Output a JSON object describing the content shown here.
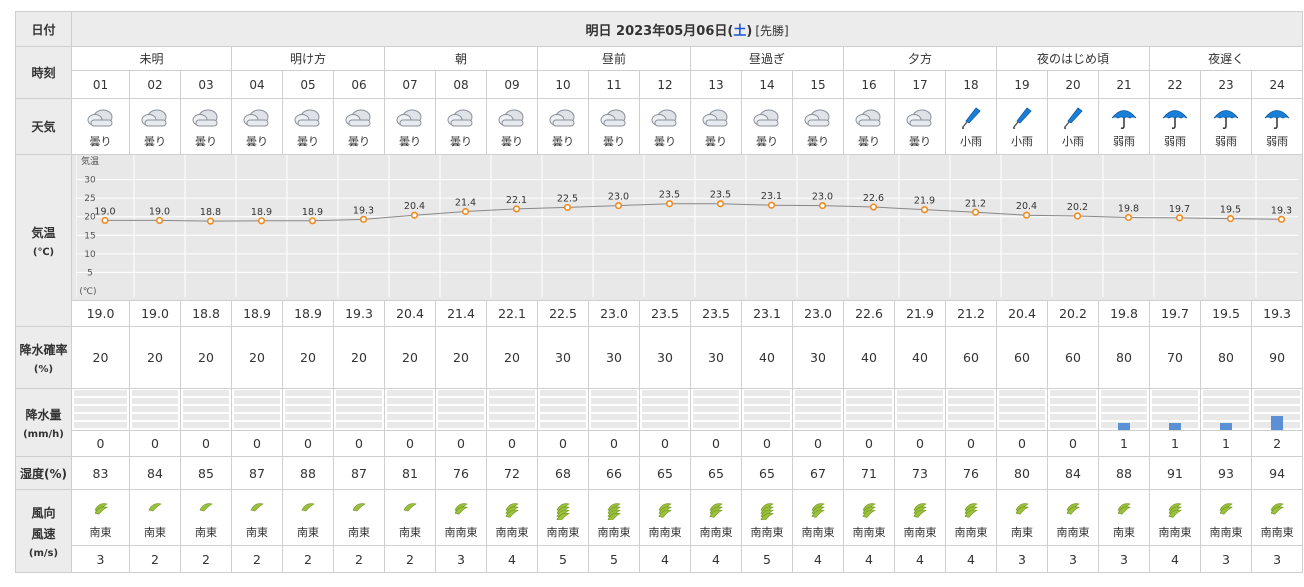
{
  "labels": {
    "date": "日付",
    "time": "時刻",
    "weather": "天気",
    "temp": "気温",
    "temp_unit": "(℃)",
    "chart_top": "気温",
    "chart_bottom": "(℃)",
    "precip_prob": "降水確率",
    "precip_prob_unit": "(%)",
    "precip_amount": "降水量",
    "precip_amount_unit": "(mm/h)",
    "humidity": "湿度(%)",
    "wind_dir": "風向",
    "wind_speed": "風速",
    "wind_unit": "(m/s)"
  },
  "date": {
    "prefix": "明日 2023年05月06日(",
    "dow": "土",
    "suffix": ")",
    "tag": "[先勝]"
  },
  "periods": [
    "未明",
    "明け方",
    "朝",
    "昼前",
    "昼過ぎ",
    "夕方",
    "夜のはじめ頃",
    "夜遅く"
  ],
  "hours": [
    "01",
    "02",
    "03",
    "04",
    "05",
    "06",
    "07",
    "08",
    "09",
    "10",
    "11",
    "12",
    "13",
    "14",
    "15",
    "16",
    "17",
    "18",
    "19",
    "20",
    "21",
    "22",
    "23",
    "24"
  ],
  "weather": [
    {
      "icon": "cloud",
      "label": "曇り"
    },
    {
      "icon": "cloud",
      "label": "曇り"
    },
    {
      "icon": "cloud",
      "label": "曇り"
    },
    {
      "icon": "cloud",
      "label": "曇り"
    },
    {
      "icon": "cloud",
      "label": "曇り"
    },
    {
      "icon": "cloud",
      "label": "曇り"
    },
    {
      "icon": "cloud",
      "label": "曇り"
    },
    {
      "icon": "cloud",
      "label": "曇り"
    },
    {
      "icon": "cloud",
      "label": "曇り"
    },
    {
      "icon": "cloud",
      "label": "曇り"
    },
    {
      "icon": "cloud",
      "label": "曇り"
    },
    {
      "icon": "cloud",
      "label": "曇り"
    },
    {
      "icon": "cloud",
      "label": "曇り"
    },
    {
      "icon": "cloud",
      "label": "曇り"
    },
    {
      "icon": "cloud",
      "label": "曇り"
    },
    {
      "icon": "cloud",
      "label": "曇り"
    },
    {
      "icon": "cloud",
      "label": "曇り"
    },
    {
      "icon": "umbrella-closed",
      "label": "小雨"
    },
    {
      "icon": "umbrella-closed",
      "label": "小雨"
    },
    {
      "icon": "umbrella-closed",
      "label": "小雨"
    },
    {
      "icon": "umbrella-open",
      "label": "弱雨"
    },
    {
      "icon": "umbrella-open",
      "label": "弱雨"
    },
    {
      "icon": "umbrella-open",
      "label": "弱雨"
    },
    {
      "icon": "umbrella-open",
      "label": "弱雨"
    }
  ],
  "temps": [
    "19.0",
    "19.0",
    "18.8",
    "18.9",
    "18.9",
    "19.3",
    "20.4",
    "21.4",
    "22.1",
    "22.5",
    "23.0",
    "23.5",
    "23.5",
    "23.1",
    "23.0",
    "22.6",
    "21.9",
    "21.2",
    "20.4",
    "20.2",
    "19.8",
    "19.7",
    "19.5",
    "19.3"
  ],
  "precip_prob": [
    "20",
    "20",
    "20",
    "20",
    "20",
    "20",
    "20",
    "20",
    "20",
    "30",
    "30",
    "30",
    "30",
    "40",
    "30",
    "40",
    "40",
    "60",
    "60",
    "60",
    "80",
    "70",
    "80",
    "90"
  ],
  "precip_amount": [
    "0",
    "0",
    "0",
    "0",
    "0",
    "0",
    "0",
    "0",
    "0",
    "0",
    "0",
    "0",
    "0",
    "0",
    "0",
    "0",
    "0",
    "0",
    "0",
    "0",
    "1",
    "1",
    "1",
    "2"
  ],
  "humidity": [
    "83",
    "84",
    "85",
    "87",
    "88",
    "87",
    "81",
    "76",
    "72",
    "68",
    "66",
    "65",
    "65",
    "65",
    "67",
    "71",
    "73",
    "76",
    "80",
    "84",
    "88",
    "91",
    "93",
    "94"
  ],
  "wind": [
    {
      "dir": "南東",
      "speed": "3"
    },
    {
      "dir": "南東",
      "speed": "2"
    },
    {
      "dir": "南東",
      "speed": "2"
    },
    {
      "dir": "南東",
      "speed": "2"
    },
    {
      "dir": "南東",
      "speed": "2"
    },
    {
      "dir": "南東",
      "speed": "2"
    },
    {
      "dir": "南東",
      "speed": "2"
    },
    {
      "dir": "南南東",
      "speed": "3"
    },
    {
      "dir": "南南東",
      "speed": "4"
    },
    {
      "dir": "南南東",
      "speed": "5"
    },
    {
      "dir": "南南東",
      "speed": "5"
    },
    {
      "dir": "南南東",
      "speed": "4"
    },
    {
      "dir": "南南東",
      "speed": "4"
    },
    {
      "dir": "南南東",
      "speed": "5"
    },
    {
      "dir": "南南東",
      "speed": "4"
    },
    {
      "dir": "南南東",
      "speed": "4"
    },
    {
      "dir": "南南東",
      "speed": "4"
    },
    {
      "dir": "南南東",
      "speed": "4"
    },
    {
      "dir": "南東",
      "speed": "3"
    },
    {
      "dir": "南南東",
      "speed": "3"
    },
    {
      "dir": "南東",
      "speed": "3"
    },
    {
      "dir": "南南東",
      "speed": "4"
    },
    {
      "dir": "南南東",
      "speed": "3"
    },
    {
      "dir": "南南東",
      "speed": "3"
    }
  ],
  "colors": {
    "line": "#888888",
    "dot": "#f08a1d",
    "rain_bar": "#5b8fd6",
    "leaf": "#9bc23a",
    "umbrella": "#1a7fd6",
    "dow": "#1a56d6"
  },
  "chart_data": {
    "type": "line",
    "x": [
      "01",
      "02",
      "03",
      "04",
      "05",
      "06",
      "07",
      "08",
      "09",
      "10",
      "11",
      "12",
      "13",
      "14",
      "15",
      "16",
      "17",
      "18",
      "19",
      "20",
      "21",
      "22",
      "23",
      "24"
    ],
    "y": [
      19.0,
      19.0,
      18.8,
      18.9,
      18.9,
      19.3,
      20.4,
      21.4,
      22.1,
      22.5,
      23.0,
      23.5,
      23.5,
      23.1,
      23.0,
      22.6,
      21.9,
      21.2,
      20.4,
      20.2,
      19.8,
      19.7,
      19.5,
      19.3
    ],
    "yticks": [
      "30",
      "25",
      "20",
      "15",
      "10",
      "5"
    ],
    "ylim": [
      0,
      35
    ],
    "grid": true
  }
}
